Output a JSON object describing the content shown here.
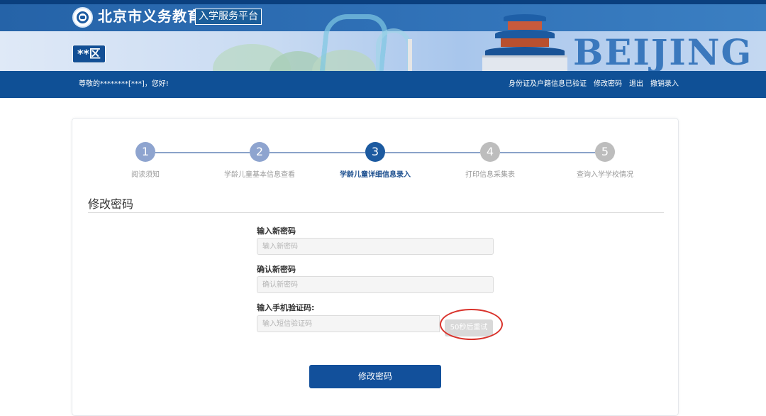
{
  "header": {
    "site_title": "北京市义务教育",
    "site_subtitle": "入学服务平台",
    "district": "**区",
    "banner_word": "BEIJING"
  },
  "navbar": {
    "greeting": "尊敬的********[***]，您好!",
    "links": [
      {
        "label": "身份证及户籍信息已验证"
      },
      {
        "label": "修改密码"
      },
      {
        "label": "退出"
      },
      {
        "label": "撤销录入"
      }
    ]
  },
  "steps": [
    {
      "number": "1",
      "label": "阅读须知",
      "state": "done"
    },
    {
      "number": "2",
      "label": "学龄儿童基本信息查看",
      "state": "done"
    },
    {
      "number": "3",
      "label": "学龄儿童详细信息录入",
      "state": "active"
    },
    {
      "number": "4",
      "label": "打印信息采集表",
      "state": "todo"
    },
    {
      "number": "5",
      "label": "查询入学学校情况",
      "state": "todo"
    }
  ],
  "form": {
    "title": "修改密码",
    "new_password": {
      "label": "输入新密码",
      "placeholder": "输入新密码",
      "value": ""
    },
    "confirm_password": {
      "label": "确认新密码",
      "placeholder": "确认新密码",
      "value": ""
    },
    "sms_code": {
      "label": "输入手机验证码:",
      "placeholder": "输入短信验证码",
      "value": ""
    },
    "sms_button_label": "50秒后重试",
    "submit_label": "修改密码"
  },
  "colors": {
    "brand_blue": "#0f5096",
    "active_step": "#1c5aa0",
    "done_step": "#8ea4cf",
    "todo_step": "#bdbdbd",
    "annotation_red": "#d9322b"
  }
}
